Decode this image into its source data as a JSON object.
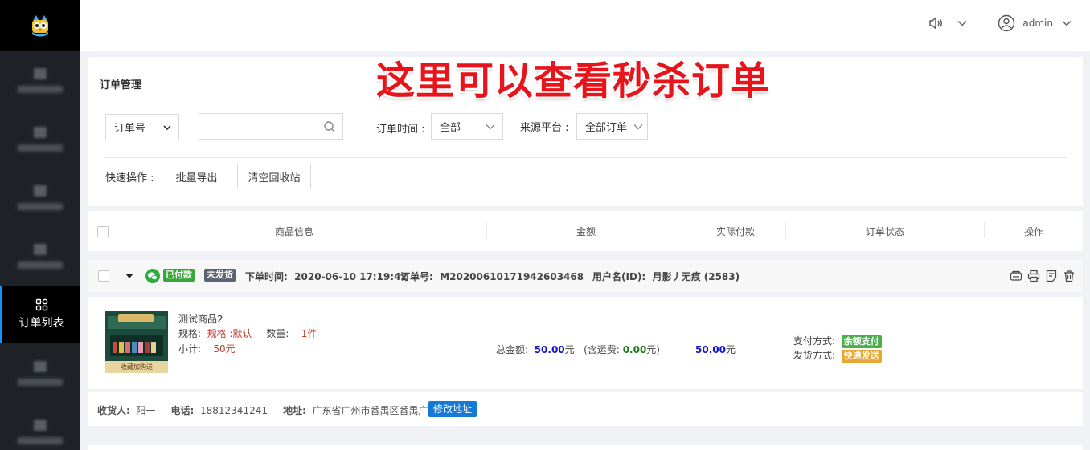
{
  "header": {
    "username": "admin"
  },
  "overlay_title": "这里可以查看秒杀订单",
  "sidebar": {
    "active_label": "订单列表"
  },
  "panel": {
    "title": "订单管理",
    "search_type": "订单号",
    "order_time_label": "订单时间 :",
    "order_time_value": "全部",
    "source_label": "来源平台 :",
    "source_value": "全部订单",
    "quick_label": "快速操作 :",
    "export_btn": "批量导出",
    "clear_btn": "清空回收站"
  },
  "table_headers": [
    "商品信息",
    "金额",
    "实际付款",
    "订单状态",
    "操作"
  ],
  "order": {
    "paid_badge": "已付款",
    "ship_badge": "未发货",
    "time_label": "下单时间:",
    "time": "2020-06-10 17:19:42",
    "no_label": "订单号:",
    "no": "M20200610171942603468",
    "user_label": "用户名(ID):",
    "user": "月影丿无痕 (2583)",
    "image_caption": "收藏加购送",
    "product_name": "测试商品2",
    "spec_label": "规格:",
    "spec_value": "规格 :默认",
    "qty_label": "数量:",
    "qty_value": "1件",
    "subtotal_label": "小计:",
    "subtotal_value": "50元",
    "total_label": "总金额:",
    "total_value": "50.00",
    "yuan": "元",
    "shipping_label": "(含运费:",
    "shipping_value": "0.00",
    "shipping_suffix": "元)",
    "actual_value": "50.00",
    "pay_method_label": "支付方式:",
    "pay_method": "余额支付",
    "ship_method_label": "发货方式:",
    "ship_method": "快递发送",
    "consignee_label": "收货人:",
    "consignee": "阳一",
    "phone_label": "电话:",
    "phone": "18812341241",
    "address_label": "地址:",
    "address": "广东省广州市番禺区番禺广场",
    "edit_address_btn": "修改地址"
  },
  "colors": {
    "paid": "#3aa63a",
    "unshipped": "#5b6270",
    "balance": "#4cae4c",
    "express": "#e8a735",
    "edit": "#1479d7"
  }
}
